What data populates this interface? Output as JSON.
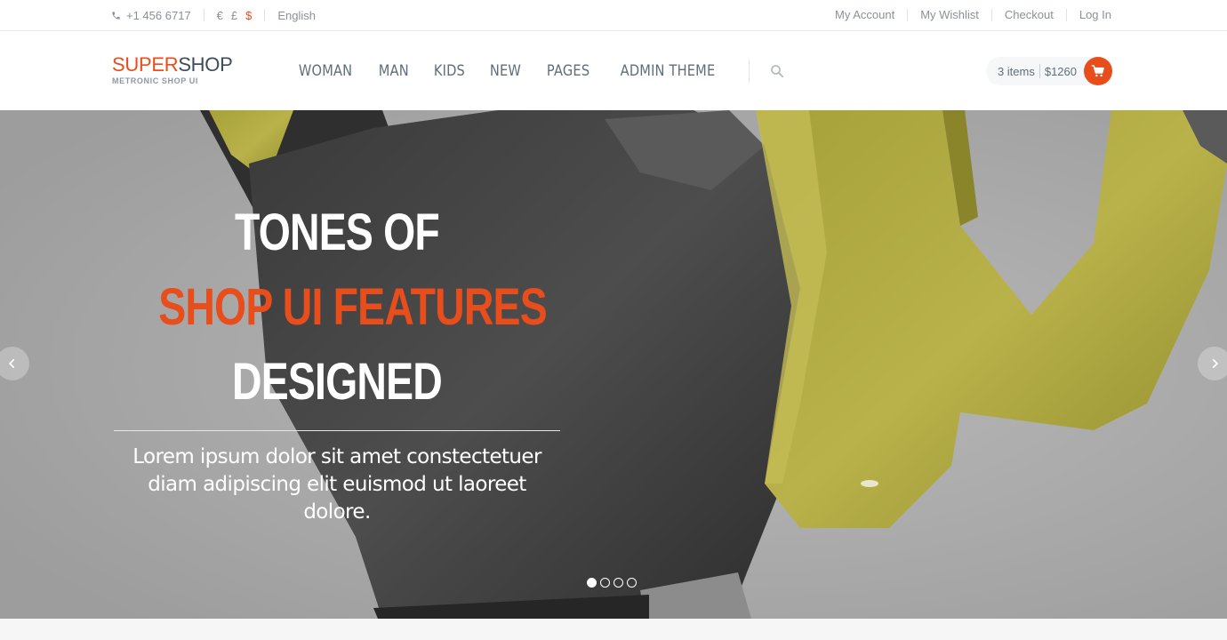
{
  "topbar": {
    "phone": "+1 456 6717",
    "currencies": [
      "€",
      "£",
      "$"
    ],
    "active_currency": "$",
    "language": "English",
    "links": [
      "My Account",
      "My Wishlist",
      "Checkout",
      "Log In"
    ]
  },
  "header": {
    "logo_part1": "SUPER",
    "logo_part2": "SHOP",
    "logo_tagline": "METRONIC SHOP UI",
    "nav": [
      "WOMAN",
      "MAN",
      "KIDS",
      "NEW",
      "PAGES",
      "ADMIN THEME"
    ],
    "cart_items": "3 items",
    "cart_total": "$1260"
  },
  "hero": {
    "line1": "TONES OF",
    "line2": "SHOP UI FEATURES",
    "line3": "DESIGNED",
    "subtitle": "Lorem ipsum dolor sit amet constectetuer diam adipiscing elit euismod ut laoreet dolore.",
    "slide_count": 4,
    "active_slide": 1
  },
  "icons": {
    "phone": "phone-icon",
    "search": "search-icon",
    "cart": "shopping-cart-icon",
    "prev": "chevron-left-icon",
    "next": "chevron-right-icon"
  },
  "colors": {
    "accent": "#e84d1c",
    "logo_dark": "#3e4d5c",
    "nav_text": "#5f6e7b"
  }
}
